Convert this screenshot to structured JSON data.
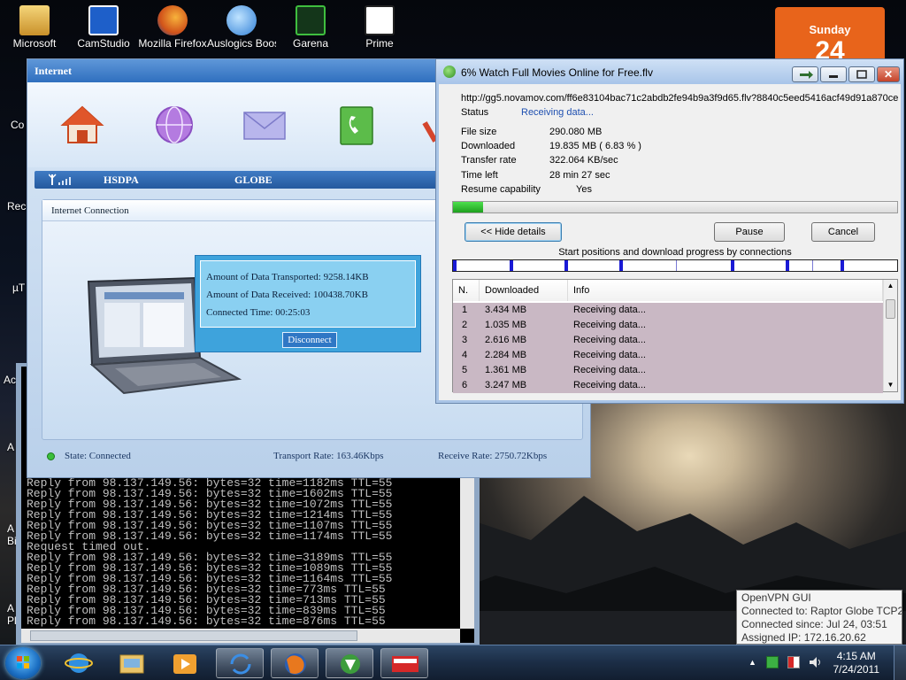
{
  "desktop": {
    "icons": [
      {
        "label": "Microsoft",
        "icon": "folder-icon",
        "color": "#d8a93a"
      },
      {
        "label": "CamStudio",
        "icon": "camstudio-icon",
        "color": "#1e5fc9"
      },
      {
        "label": "Mozilla Firefox",
        "icon": "firefox-icon",
        "color": "#e0731c"
      },
      {
        "label": "Auslogics BoostSpeed",
        "icon": "auslogics-icon",
        "color": "#2f7fd6"
      },
      {
        "label": "Garena",
        "icon": "garena-icon",
        "color": "#1d7a1d"
      },
      {
        "label": "Prime",
        "icon": "prime-icon",
        "color": "#222222"
      }
    ],
    "side_labels": [
      "Co",
      "Rec",
      "µT",
      "Ac",
      "A",
      "A Bi",
      "A Pl"
    ]
  },
  "calendar": {
    "day_name": "Sunday",
    "day_number": "24"
  },
  "internet_window": {
    "title": "Internet",
    "network_type": "HSDPA",
    "operator": "GLOBE",
    "panel_title": "Internet Connection",
    "data_transported": "Amount of Data Transported: 9258.14KB",
    "data_received": "Amount of Data Received: 100438.70KB",
    "connected_time": "Connected Time: 00:25:03",
    "disconnect_label": "Disconnect",
    "state": "State: Connected",
    "transport_rate": "Transport Rate: 163.46Kbps",
    "receive_rate": "Receive Rate: 2750.72Kbps"
  },
  "download_window": {
    "title": "6% Watch Full Movies Online for Free.flv",
    "url": "http://gg5.novamov.com/ff6e83104bac71c2abdb2fe94b9a3f9d65.flv?8840c5eed5416acf49d91a870ce",
    "status_key": "Status",
    "status_value": "Receiving data...",
    "file_size_key": "File size",
    "file_size_value": "290.080  MB",
    "downloaded_key": "Downloaded",
    "downloaded_value": "19.835  MB  ( 6.83 % )",
    "transfer_rate_key": "Transfer rate",
    "transfer_rate_value": "322.064  KB/sec",
    "time_left_key": "Time left",
    "time_left_value": "28 min 27 sec",
    "resume_key": "Resume capability",
    "resume_value": "Yes",
    "progress_fraction": 0.0683,
    "hide_details_label": "<< Hide details",
    "pause_label": "Pause",
    "cancel_label": "Cancel",
    "segments_label": "Start positions and download progress by connections",
    "columns": [
      "N.",
      "Downloaded",
      "Info"
    ],
    "connections": [
      {
        "n": "1",
        "downloaded": "3.434  MB",
        "info": "Receiving data..."
      },
      {
        "n": "2",
        "downloaded": "1.035  MB",
        "info": "Receiving data..."
      },
      {
        "n": "3",
        "downloaded": "2.616  MB",
        "info": "Receiving data..."
      },
      {
        "n": "4",
        "downloaded": "2.284  MB",
        "info": "Receiving data..."
      },
      {
        "n": "5",
        "downloaded": "1.361  MB",
        "info": "Receiving data..."
      },
      {
        "n": "6",
        "downloaded": "3.247  MB",
        "info": "Receiving data..."
      }
    ]
  },
  "cmd": {
    "lines": [
      "Reply from 98.137.149.56: bytes=32 time=1182ms TTL=55",
      "Reply from 98.137.149.56: bytes=32 time=1602ms TTL=55",
      "Reply from 98.137.149.56: bytes=32 time=1072ms TTL=55",
      "Reply from 98.137.149.56: bytes=32 time=1214ms TTL=55",
      "Reply from 98.137.149.56: bytes=32 time=1107ms TTL=55",
      "Reply from 98.137.149.56: bytes=32 time=1174ms TTL=55",
      "Request timed out.",
      "Reply from 98.137.149.56: bytes=32 time=3189ms TTL=55",
      "Reply from 98.137.149.56: bytes=32 time=1089ms TTL=55",
      "Reply from 98.137.149.56: bytes=32 time=1164ms TTL=55",
      "Reply from 98.137.149.56: bytes=32 time=773ms TTL=55",
      "Reply from 98.137.149.56: bytes=32 time=713ms TTL=55",
      "Reply from 98.137.149.56: bytes=32 time=839ms TTL=55",
      "Reply from 98.137.149.56: bytes=32 time=876ms TTL=55"
    ]
  },
  "tooltip": {
    "line1": "OpenVPN GUI",
    "line2": "Connected to: Raptor Globe TCP2",
    "line3": "Connected since: Jul 24, 03:51",
    "line4": "Assigned IP: 172.16.20.62"
  },
  "taskbar": {
    "time": "4:15 AM",
    "date": "7/24/2011",
    "apps": [
      "start-orb",
      "internet-explorer-icon",
      "windows-explorer-icon",
      "media-player-icon",
      "sync-icon",
      "firefox-icon",
      "idm-icon",
      "smart-bro-icon"
    ]
  }
}
